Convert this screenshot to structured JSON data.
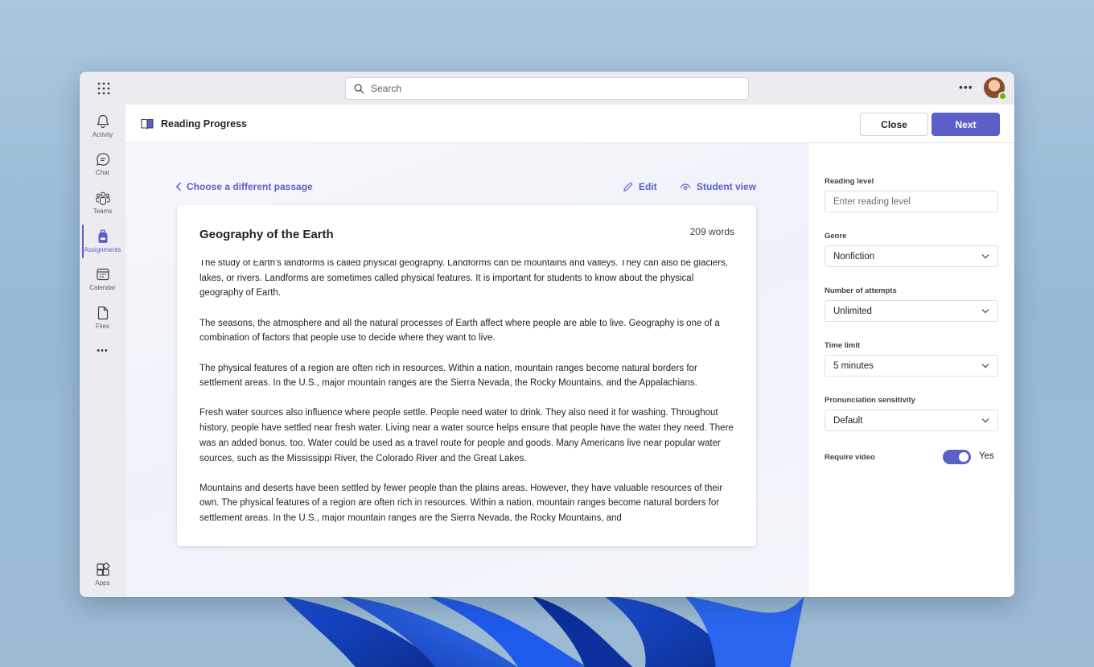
{
  "search": {
    "placeholder": "Search"
  },
  "rail": {
    "items": [
      {
        "label": "Activity",
        "icon": "bell-icon"
      },
      {
        "label": "Chat",
        "icon": "chat-icon"
      },
      {
        "label": "Teams",
        "icon": "teams-icon"
      },
      {
        "label": "Assignments",
        "icon": "backpack-icon",
        "active": true
      },
      {
        "label": "Calendar",
        "icon": "calendar-icon"
      },
      {
        "label": "Files",
        "icon": "file-icon"
      }
    ],
    "more": "•••",
    "apps": {
      "label": "Apps",
      "icon": "apps-icon"
    }
  },
  "header": {
    "title": "Reading Progress",
    "close_label": "Close",
    "next_label": "Next"
  },
  "content": {
    "back_label": "Choose a different passage",
    "edit_label": "Edit",
    "student_view_label": "Student view"
  },
  "passage": {
    "title": "Geography of the Earth",
    "word_count": "209 words",
    "paragraphs": [
      "The study of Earth's landforms is called physical geography. Landforms can be mountains and valleys. They can also be glaciers, lakes, or rivers. Landforms are sometimes called physical features. It is important for students to know about the physical geography of Earth.",
      "The seasons, the atmosphere and all the natural processes of Earth affect where people are able to live. Geography is one of a combination of factors that people use to decide where they want to live.",
      "The physical features of a region are often rich in resources. Within a nation, mountain ranges become natural borders for settlement areas. In the U.S., major mountain ranges are the Sierra Nevada, the Rocky Mountains, and the Appalachians.",
      "Fresh water sources also influence where people settle. People need water to drink. They also need it for washing. Throughout history, people have settled near fresh water. Living near a water source helps ensure that people have the water they need. There was an added bonus, too. Water could be used as a travel route for people and goods. Many Americans live near popular water sources, such as the Mississippi River, the Colorado River and the Great Lakes.",
      "Mountains and deserts have been settled by fewer people than the plains areas. However, they have valuable resources of their own. The physical features of a region are often rich in resources. Within a nation, mountain ranges become natural borders for settlement areas. In the U.S., major mountain ranges are the Sierra Nevada, the Rocky Mountains, and"
    ]
  },
  "settings": {
    "reading_level": {
      "label": "Reading level",
      "placeholder": "Enter reading level"
    },
    "genre": {
      "label": "Genre",
      "value": "Nonfiction"
    },
    "attempts": {
      "label": "Number of attempts",
      "value": "Unlimited"
    },
    "time_limit": {
      "label": "Time limit",
      "value": "5 minutes"
    },
    "pronunciation": {
      "label": "Pronunciation sensitivity",
      "value": "Default"
    },
    "require_video": {
      "label": "Require video",
      "value": "Yes",
      "on": true
    }
  },
  "colors": {
    "accent": "#5b5fc7",
    "presence": "#6bb700"
  }
}
